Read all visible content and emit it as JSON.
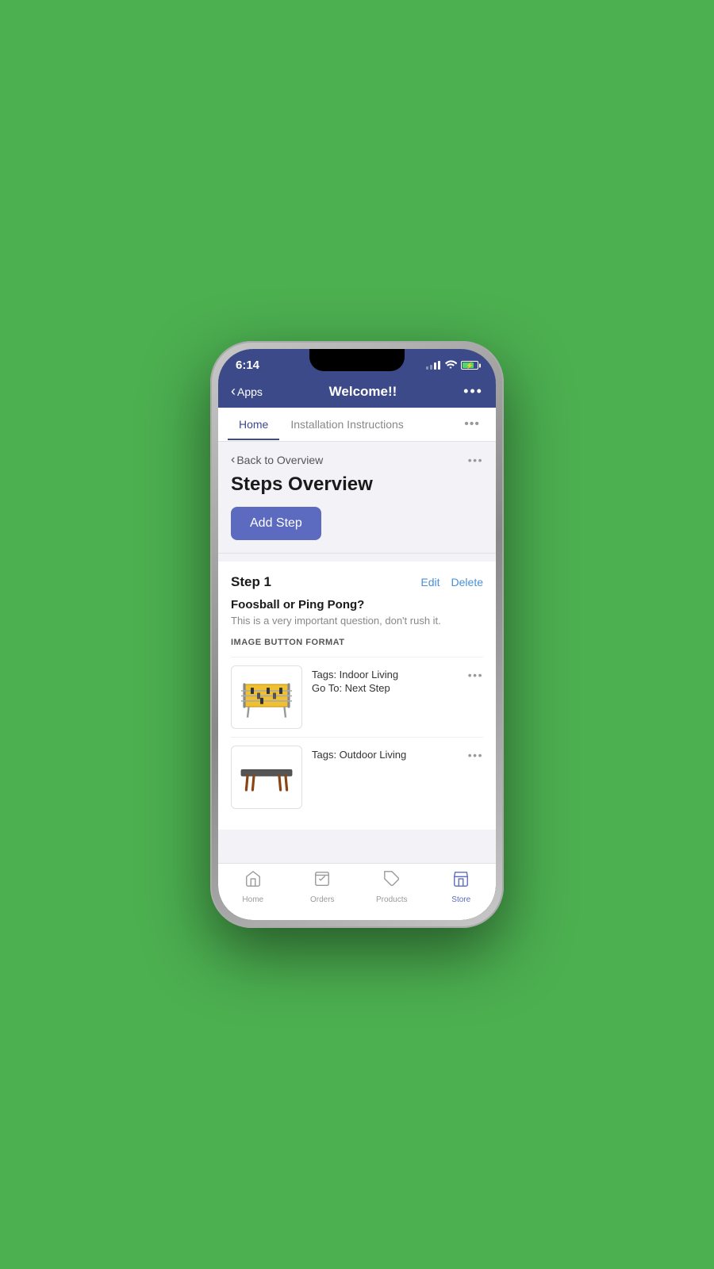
{
  "device": {
    "time": "6:14"
  },
  "nav": {
    "back_label": "Apps",
    "title": "Welcome!!",
    "more_dots": "•••"
  },
  "tabs": [
    {
      "id": "home",
      "label": "Home",
      "active": true
    },
    {
      "id": "installation",
      "label": "Installation Instructions",
      "active": false
    }
  ],
  "steps_overview": {
    "back_link": "Back to Overview",
    "title": "Steps Overview",
    "add_step_label": "Add Step"
  },
  "steps": [
    {
      "number": "Step 1",
      "edit_label": "Edit",
      "delete_label": "Delete",
      "question": "Foosball or Ping Pong?",
      "description": "This is a very important question, don't rush it.",
      "format_label": "IMAGE BUTTON FORMAT",
      "buttons": [
        {
          "tags": "Tags: Indoor Living",
          "goto": "Go To: Next Step"
        },
        {
          "tags": "Tags: Outdoor Living",
          "goto": ""
        }
      ]
    }
  ],
  "bottom_nav": [
    {
      "id": "home",
      "label": "Home",
      "icon": "home",
      "active": false
    },
    {
      "id": "orders",
      "label": "Orders",
      "icon": "orders",
      "active": false
    },
    {
      "id": "products",
      "label": "Products",
      "icon": "products",
      "active": false
    },
    {
      "id": "store",
      "label": "Store",
      "icon": "store",
      "active": true
    }
  ],
  "colors": {
    "nav_bg": "#3d4a8a",
    "accent": "#5c6bc0",
    "link_blue": "#4a90d9",
    "active_tab": "#3d4a8a"
  }
}
